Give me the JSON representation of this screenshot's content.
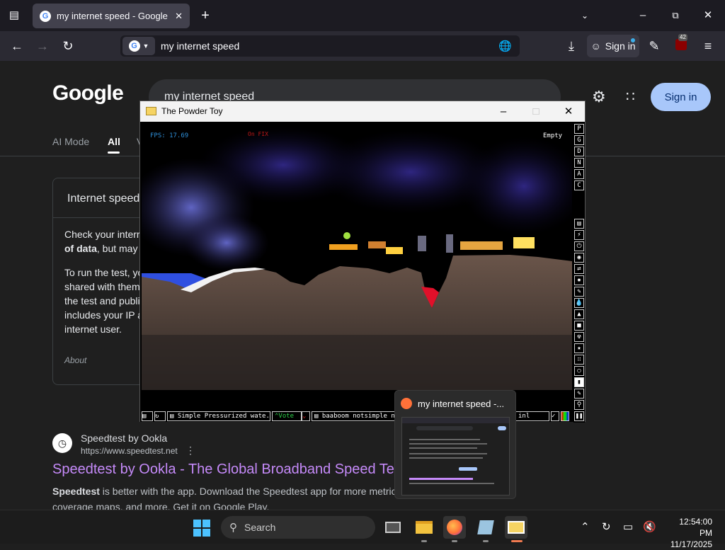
{
  "browser": {
    "tab_title": "my internet speed - Google Sea",
    "url_text": "my internet speed",
    "signin_label": "Sign in",
    "extension_badge": "42"
  },
  "google": {
    "logo": "Google",
    "search_query": "my internet speed",
    "signin_label": "Sign in",
    "tabs": [
      "AI Mode",
      "All",
      "V"
    ],
    "panel": {
      "title": "Internet speed",
      "para1_line1": "Check your interr",
      "para1_line2a": "of data",
      "para1_line2b": ", but may",
      "para2_lines": [
        "To run the test, yo",
        "shared with them",
        "the test and publi",
        "includes your IP a",
        "internet user."
      ],
      "about": "About"
    },
    "result": {
      "site_name": "Speedtest by Ookla",
      "site_url": "https://www.speedtest.net",
      "title": "Speedtest by Ookla - The Global Broadband Speed Te",
      "snippet_bold": "Speedtest",
      "snippet_rest": " is better with the app. Download the Speedtest app for more metric",
      "snippet_line2": "coverage maps, and more. Get it on Google Play."
    }
  },
  "powder_toy": {
    "window_title": "The Powder Toy",
    "fps": "FPS: 17.69",
    "red_label": "On FIX",
    "status_right": "Empty",
    "side_letters": [
      "P",
      "G",
      "D",
      "N",
      "A",
      "C"
    ],
    "save_name": "Simple Pressurized wate...",
    "vote_label": "Vote",
    "tags": "baaboom notsimple nu",
    "tags_end": "inl"
  },
  "preview": {
    "title": "my internet speed -..."
  },
  "taskbar": {
    "search_placeholder": "Search",
    "time": "12:54:00 PM",
    "date": "11/17/2025"
  },
  "colors": {
    "accent_blue": "#a8c7fa",
    "link_purple": "#c58af9",
    "fps_cyan": "#2e8fd8"
  }
}
